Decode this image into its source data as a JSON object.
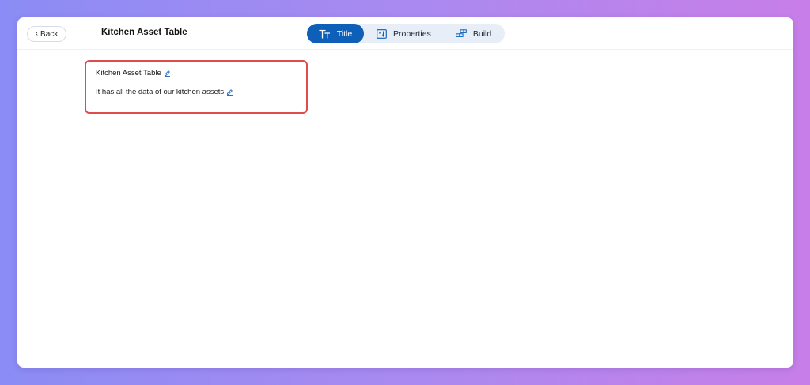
{
  "header": {
    "back_label": "Back",
    "page_title": "Kitchen Asset Table"
  },
  "tabs": [
    {
      "label": "Title",
      "icon": "text-format-icon",
      "active": true
    },
    {
      "label": "Properties",
      "icon": "sliders-icon",
      "active": false
    },
    {
      "label": "Build",
      "icon": "blocks-icon",
      "active": false
    }
  ],
  "card": {
    "name": "Kitchen Asset Table",
    "description": "It has all the data of our kitchen assets"
  },
  "colors": {
    "accent": "#0d5fb8",
    "highlight_border": "#e04b4b",
    "tabs_background": "#e7eef7"
  }
}
